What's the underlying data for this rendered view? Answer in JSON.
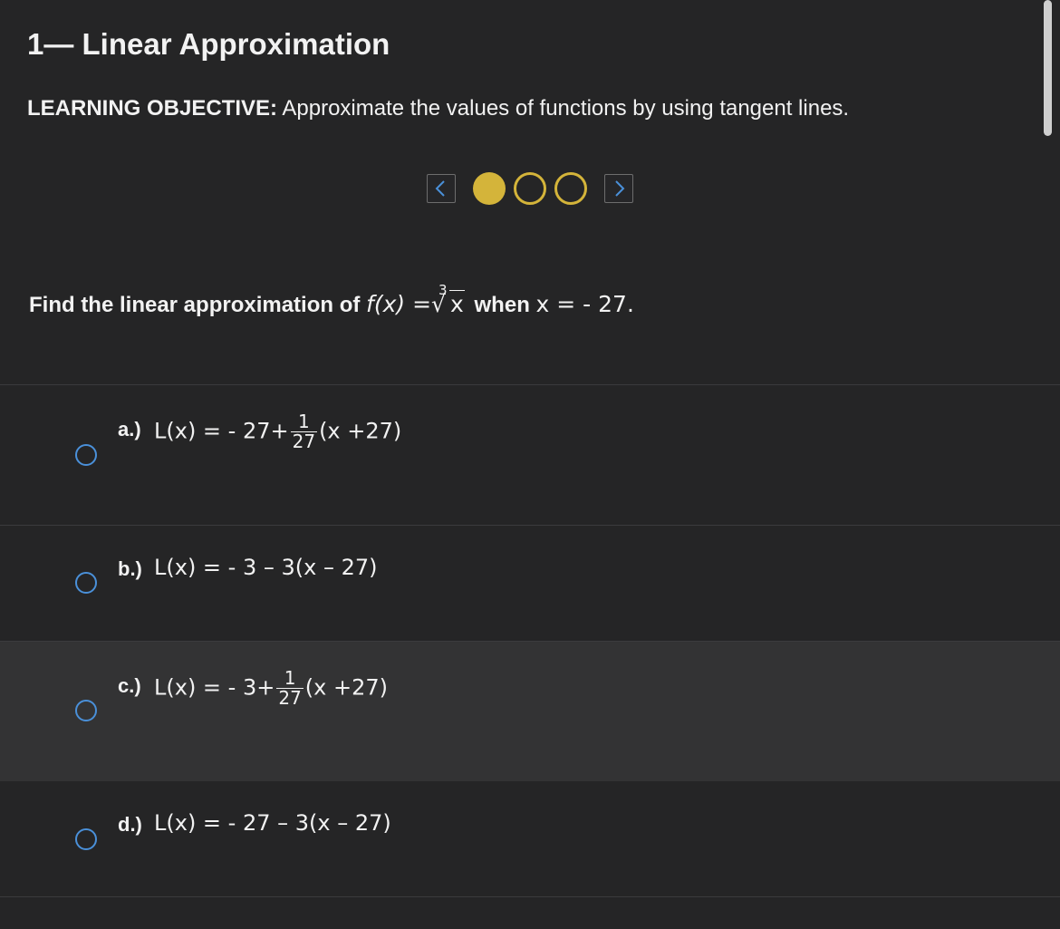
{
  "header": {
    "title": "1— Linear Approximation",
    "objective_label": "LEARNING OBJECTIVE:",
    "objective_text": "Approximate the values of functions by using tangent lines."
  },
  "pager": {
    "total": 3,
    "current": 1,
    "accent": "#d4b43a",
    "prev_icon": "chevron-left-icon",
    "next_icon": "chevron-right-icon"
  },
  "question": {
    "prefix": "Find the linear approximation of",
    "fx": "f(x)",
    "equals": "=",
    "root_index": "3",
    "radicand": "x",
    "middle": "when",
    "x_value": "x = - 27."
  },
  "options": [
    {
      "label": "a.)",
      "lhs": "L(x) = - 27+",
      "frac_num": "1",
      "frac_den": "27",
      "rhs": "(x +27)"
    },
    {
      "label": "b.)",
      "text": "L(x) = - 3 – 3(x – 27)"
    },
    {
      "label": "c.)",
      "lhs": "L(x) = - 3+",
      "frac_num": "1",
      "frac_den": "27",
      "rhs": "(x +27)"
    },
    {
      "label": "d.)",
      "text": "L(x) = - 27 – 3(x – 27)"
    }
  ],
  "colors": {
    "background": "#252526",
    "hover_row": "#333334",
    "radio": "#4a90d9",
    "nav_arrow": "#4a90d9"
  }
}
